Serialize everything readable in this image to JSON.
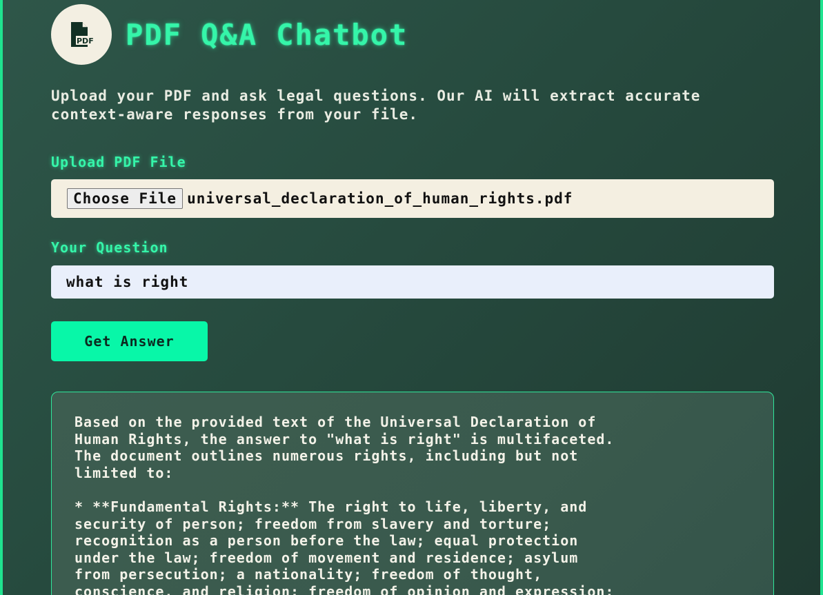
{
  "header": {
    "logo_icon": "pdf-file-icon",
    "logo_text": "PDF",
    "title": "PDF Q&A Chatbot"
  },
  "intro": "Upload your PDF and ask legal questions. Our AI will extract accurate context-aware responses from your file.",
  "upload": {
    "label": "Upload PDF File",
    "button_label": "Choose File",
    "file_name": "universal_declaration_of_human_rights.pdf"
  },
  "question": {
    "label": "Your Question",
    "value": "what is right"
  },
  "submit": {
    "label": "Get Answer"
  },
  "answer": {
    "text": "Based on the provided text of the Universal Declaration of\nHuman Rights, the answer to \"what is right\" is multifaceted.\nThe document outlines numerous rights, including but not\nlimited to:\n\n* **Fundamental Rights:** The right to life, liberty, and\nsecurity of person; freedom from slavery and torture;\nrecognition as a person before the law; equal protection\nunder the law; freedom of movement and residence; asylum\nfrom persecution; a nationality; freedom of thought,\nconscience, and religion; freedom of opinion and expression;"
  },
  "colors": {
    "accent": "#35f5a9",
    "button": "#08f7a8",
    "border": "#1fe38f"
  }
}
